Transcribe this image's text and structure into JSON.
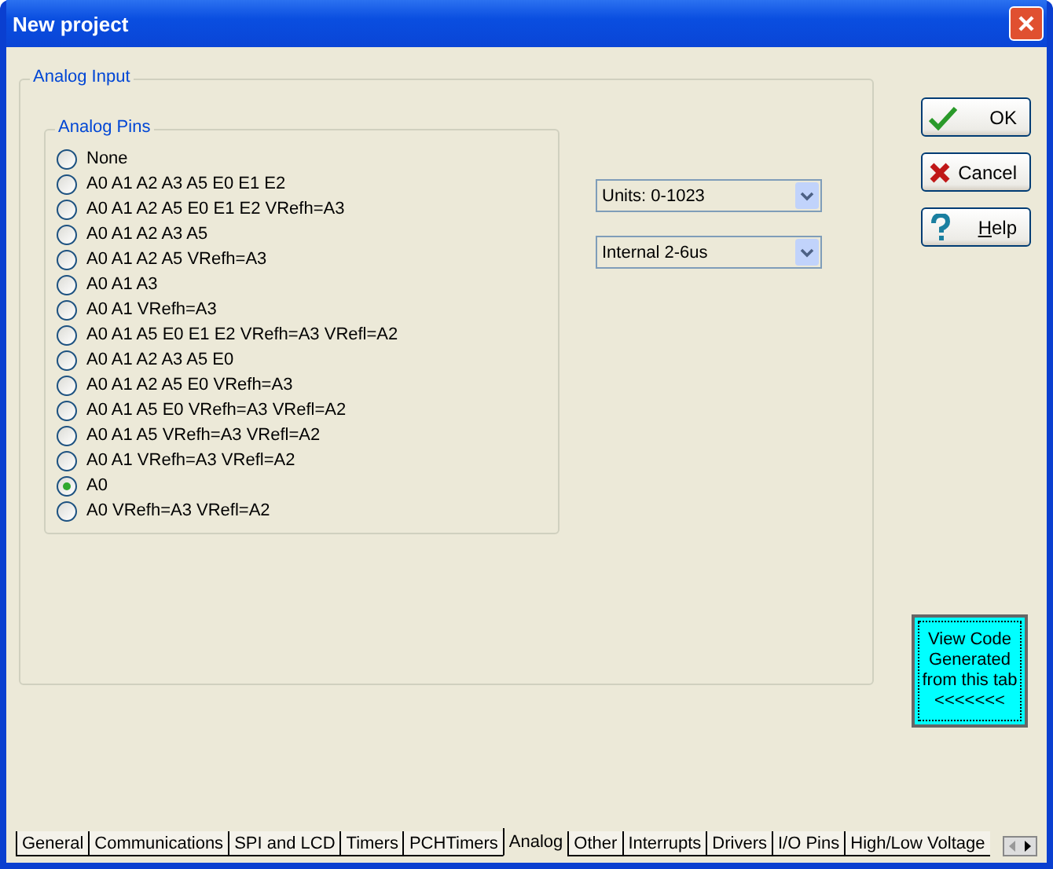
{
  "window": {
    "title": "New project"
  },
  "analog_input": {
    "title": "Analog Input",
    "analog_pins": {
      "title": "Analog Pins",
      "options": [
        {
          "label": "None",
          "selected": false
        },
        {
          "label": "A0 A1 A2 A3 A5 E0 E1 E2",
          "selected": false
        },
        {
          "label": "A0 A1 A2 A5 E0 E1 E2 VRefh=A3",
          "selected": false
        },
        {
          "label": "A0 A1 A2 A3 A5",
          "selected": false
        },
        {
          "label": "A0 A1 A2 A5 VRefh=A3",
          "selected": false
        },
        {
          "label": "A0 A1 A3",
          "selected": false
        },
        {
          "label": "A0 A1 VRefh=A3",
          "selected": false
        },
        {
          "label": "A0 A1 A5 E0 E1 E2 VRefh=A3 VRefl=A2",
          "selected": false
        },
        {
          "label": "A0 A1 A2 A3 A5 E0",
          "selected": false
        },
        {
          "label": "A0 A1 A2 A5 E0 VRefh=A3",
          "selected": false
        },
        {
          "label": "A0 A1 A5 E0 VRefh=A3 VRefl=A2",
          "selected": false
        },
        {
          "label": "A0 A1 A5 VRefh=A3 VRefl=A2",
          "selected": false
        },
        {
          "label": "A0 A1 VRefh=A3 VRefl=A2",
          "selected": false
        },
        {
          "label": "A0",
          "selected": true
        },
        {
          "label": "A0 VRefh=A3 VRefl=A2",
          "selected": false
        }
      ]
    },
    "dropdowns": [
      {
        "value": "Units: 0-1023"
      },
      {
        "value": "Internal 2-6us"
      }
    ]
  },
  "buttons": [
    {
      "kind": "ok",
      "label": "OK"
    },
    {
      "kind": "cancel",
      "label": "Cancel"
    },
    {
      "kind": "help",
      "label": "Help"
    }
  ],
  "view_code_button": {
    "lines": [
      "View Code",
      "Generated",
      "from this tab",
      "<<<<<<<"
    ]
  },
  "tabs": [
    {
      "label": "General",
      "selected": false
    },
    {
      "label": "Communications",
      "selected": false
    },
    {
      "label": "SPI and LCD",
      "selected": false
    },
    {
      "label": "Timers",
      "selected": false
    },
    {
      "label": "PCHTimers",
      "selected": false
    },
    {
      "label": "Analog",
      "selected": true
    },
    {
      "label": "Other",
      "selected": false
    },
    {
      "label": "Interrupts",
      "selected": false
    },
    {
      "label": "Drivers",
      "selected": false
    },
    {
      "label": "I/O Pins",
      "selected": false
    },
    {
      "label": "High/Low Voltage",
      "selected": false
    }
  ]
}
